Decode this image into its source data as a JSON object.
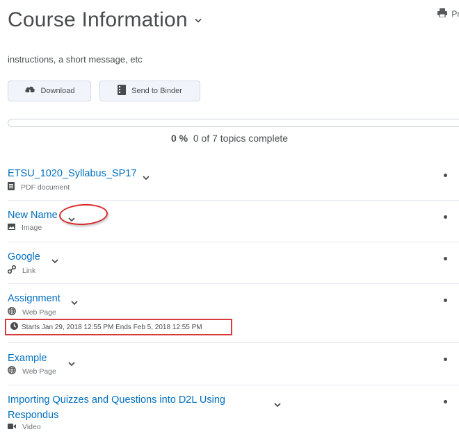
{
  "header": {
    "title": "Course Information",
    "print_label": "Print"
  },
  "description": "instructions, a short message, etc",
  "toolbar": {
    "download_label": "Download",
    "binder_label": "Send to Binder"
  },
  "progress": {
    "percent": "0 %",
    "summary": "0 of 7 topics complete",
    "fraction": 0
  },
  "topics": [
    {
      "title": "ETSU_1020_Syllabus_SP17",
      "type": "PDF document",
      "icon": "document-icon"
    },
    {
      "title": "New Name",
      "type": "Image",
      "icon": "image-icon"
    },
    {
      "title": "Google",
      "type": "Link",
      "icon": "link-icon"
    },
    {
      "title": "Assignment",
      "type": "Web Page",
      "icon": "globe-icon",
      "dates": "Starts Jan 29, 2018 12:55 PM  Ends Feb 5, 2018 12:55 PM"
    },
    {
      "title": "Example",
      "type": "Web Page",
      "icon": "globe-icon"
    },
    {
      "title_line1": "Importing Quizzes and Questions into D2L Using",
      "title_line2": "Respondus",
      "type": "Video",
      "icon": "video-icon"
    }
  ],
  "colors": {
    "link": "#006fbf",
    "text": "#494c4e",
    "highlight": "#d72a2a"
  }
}
